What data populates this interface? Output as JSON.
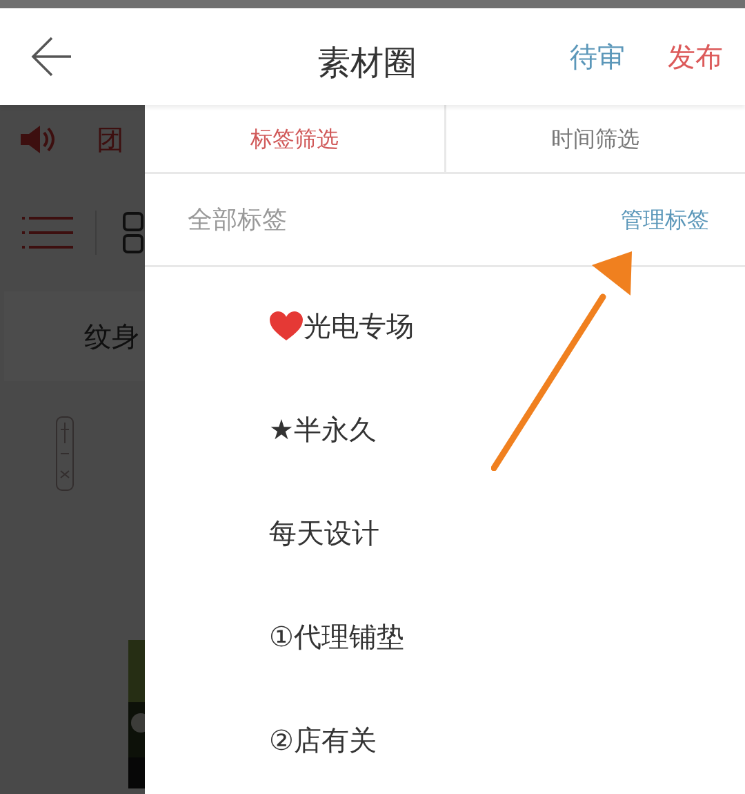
{
  "header": {
    "title": "素材圈",
    "actions": [
      {
        "label": "待审",
        "kind": "review"
      },
      {
        "label": "发布",
        "kind": "publish"
      }
    ]
  },
  "background": {
    "notice": "团",
    "category": "纹身"
  },
  "filter_tabs": [
    {
      "label": "标签筛选",
      "selected": true
    },
    {
      "label": "时间筛选",
      "selected": false
    }
  ],
  "tag_panel": {
    "title": "全部标签",
    "manage": "管理标签"
  },
  "tags": [
    {
      "label": "光电专场",
      "kind": "heart"
    },
    {
      "label": "★半永久",
      "kind": "plain"
    },
    {
      "label": "每天设计",
      "kind": "plain"
    },
    {
      "label": "①代理铺垫",
      "kind": "plain"
    },
    {
      "label": "②店有关",
      "kind": "plain"
    }
  ]
}
